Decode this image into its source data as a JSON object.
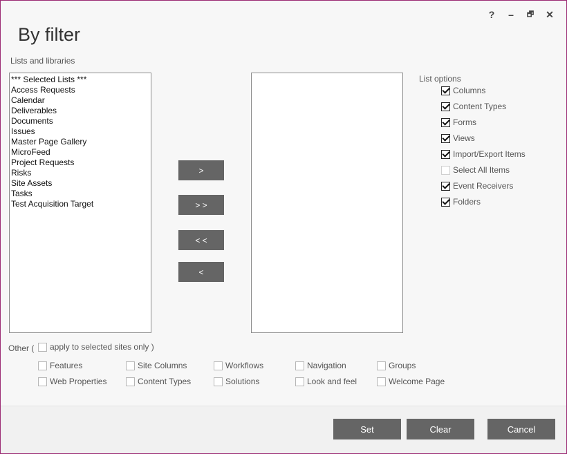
{
  "window": {
    "title": "By filter",
    "buttons": {
      "help": "?",
      "minimize": "–",
      "restore": "🗗",
      "close": "✕"
    }
  },
  "lists": {
    "label": "Lists and libraries",
    "available": [
      "*** Selected Lists ***",
      "Access Requests",
      "Calendar",
      "Deliverables",
      "Documents",
      "Issues",
      "Master Page Gallery",
      "MicroFeed",
      "Project Requests",
      "Risks",
      "Site Assets",
      "Tasks",
      "Test Acquisition Target"
    ],
    "selected": []
  },
  "move_buttons": {
    "add": ">",
    "add_all": "> >",
    "remove_all": "< <",
    "remove": "<"
  },
  "list_options": {
    "label": "List options",
    "items": [
      {
        "label": "Columns",
        "checked": true
      },
      {
        "label": "Content Types",
        "checked": true
      },
      {
        "label": "Forms",
        "checked": true
      },
      {
        "label": "Views",
        "checked": true
      },
      {
        "label": "Import/Export Items",
        "checked": true
      },
      {
        "label": "Select All Items",
        "checked": false
      },
      {
        "label": "Event Receivers",
        "checked": true
      },
      {
        "label": "Folders",
        "checked": true
      }
    ]
  },
  "other": {
    "label": "Other (",
    "apply_label": "apply to selected sites only )",
    "apply_checked": false,
    "row1": [
      "Features",
      "Site Columns",
      "Workflows",
      "Navigation",
      "Groups"
    ],
    "row2": [
      "Web Properties",
      "Content Types",
      "Solutions",
      "Look and feel",
      "Welcome Page"
    ]
  },
  "footer": {
    "set": "Set",
    "clear": "Clear",
    "cancel": "Cancel"
  }
}
